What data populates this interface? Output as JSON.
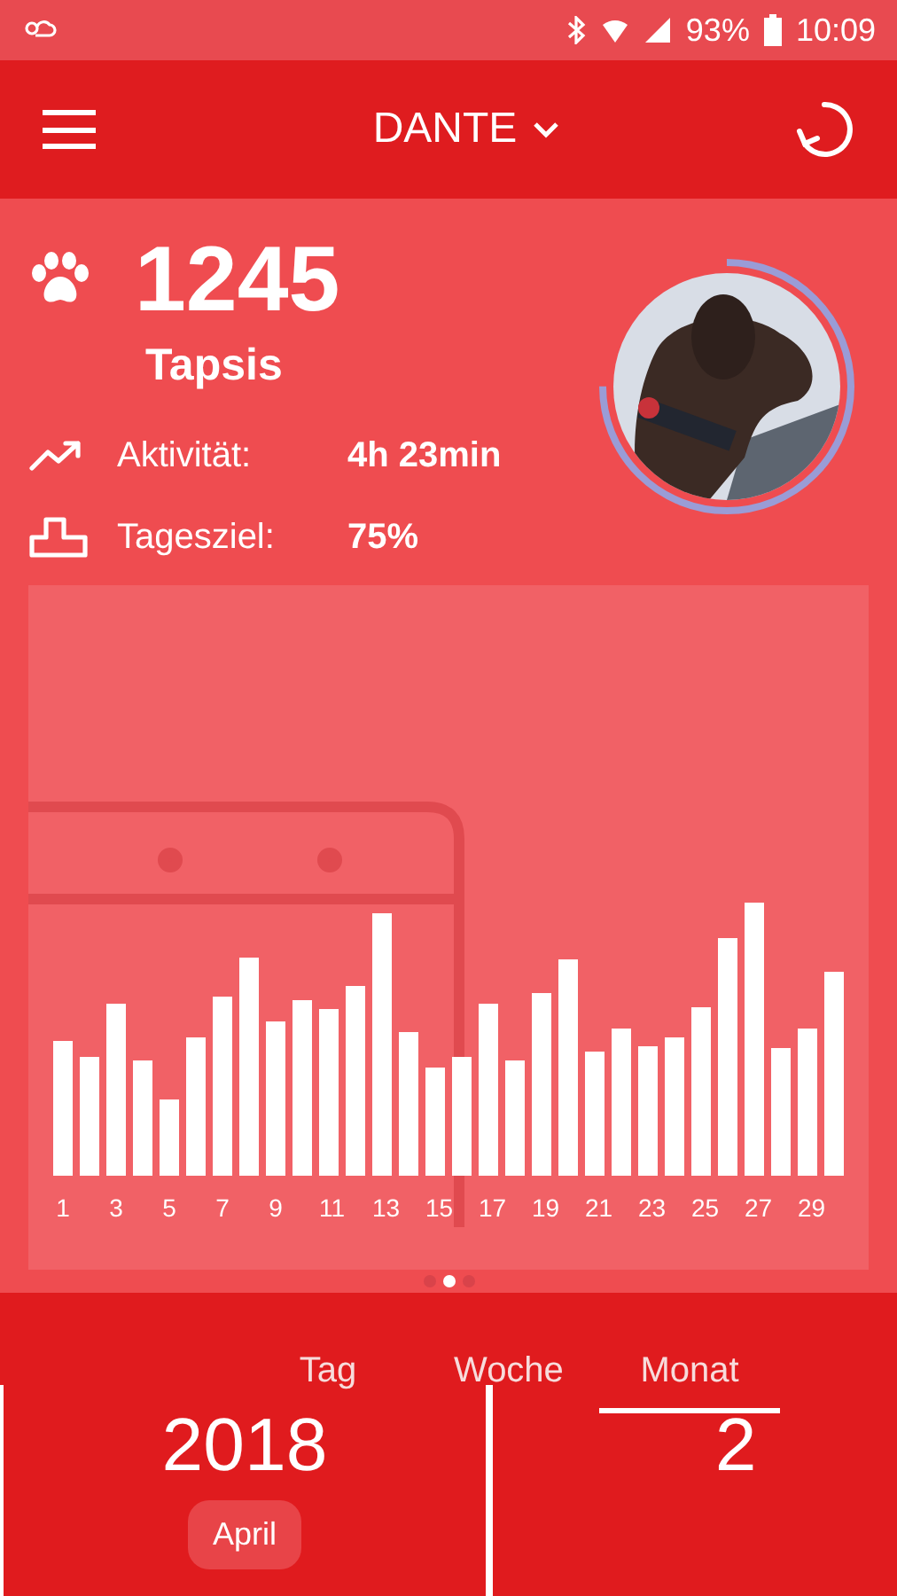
{
  "status_bar": {
    "battery": "93%",
    "time": "10:09"
  },
  "app_bar": {
    "title": "DANTE"
  },
  "summary": {
    "count": "1245",
    "count_label": "Tapsis",
    "stats": [
      {
        "kind": "activity",
        "label": "Aktivität:",
        "value": "4h 23min"
      },
      {
        "kind": "goal",
        "label": "Tagesziel:",
        "value": "75%"
      }
    ],
    "goal_ring": {
      "level": 0.75
    }
  },
  "chart": {
    "x_labels": [
      "1",
      "3",
      "5",
      "7",
      "9",
      "11",
      "13",
      "15",
      "17",
      "19",
      "21",
      "23",
      "25",
      "27",
      "29"
    ],
    "pages": [
      {
        "selected": false
      },
      {
        "selected": true
      },
      {
        "selected": false
      }
    ]
  },
  "period_tabs": [
    {
      "label": "Tag",
      "selected": false
    },
    {
      "label": "Woche",
      "selected": false
    },
    {
      "label": "Monat",
      "selected": true
    }
  ],
  "periods": [
    {
      "year": "2018",
      "month": "April"
    },
    {
      "year": "2"
    }
  ]
}
